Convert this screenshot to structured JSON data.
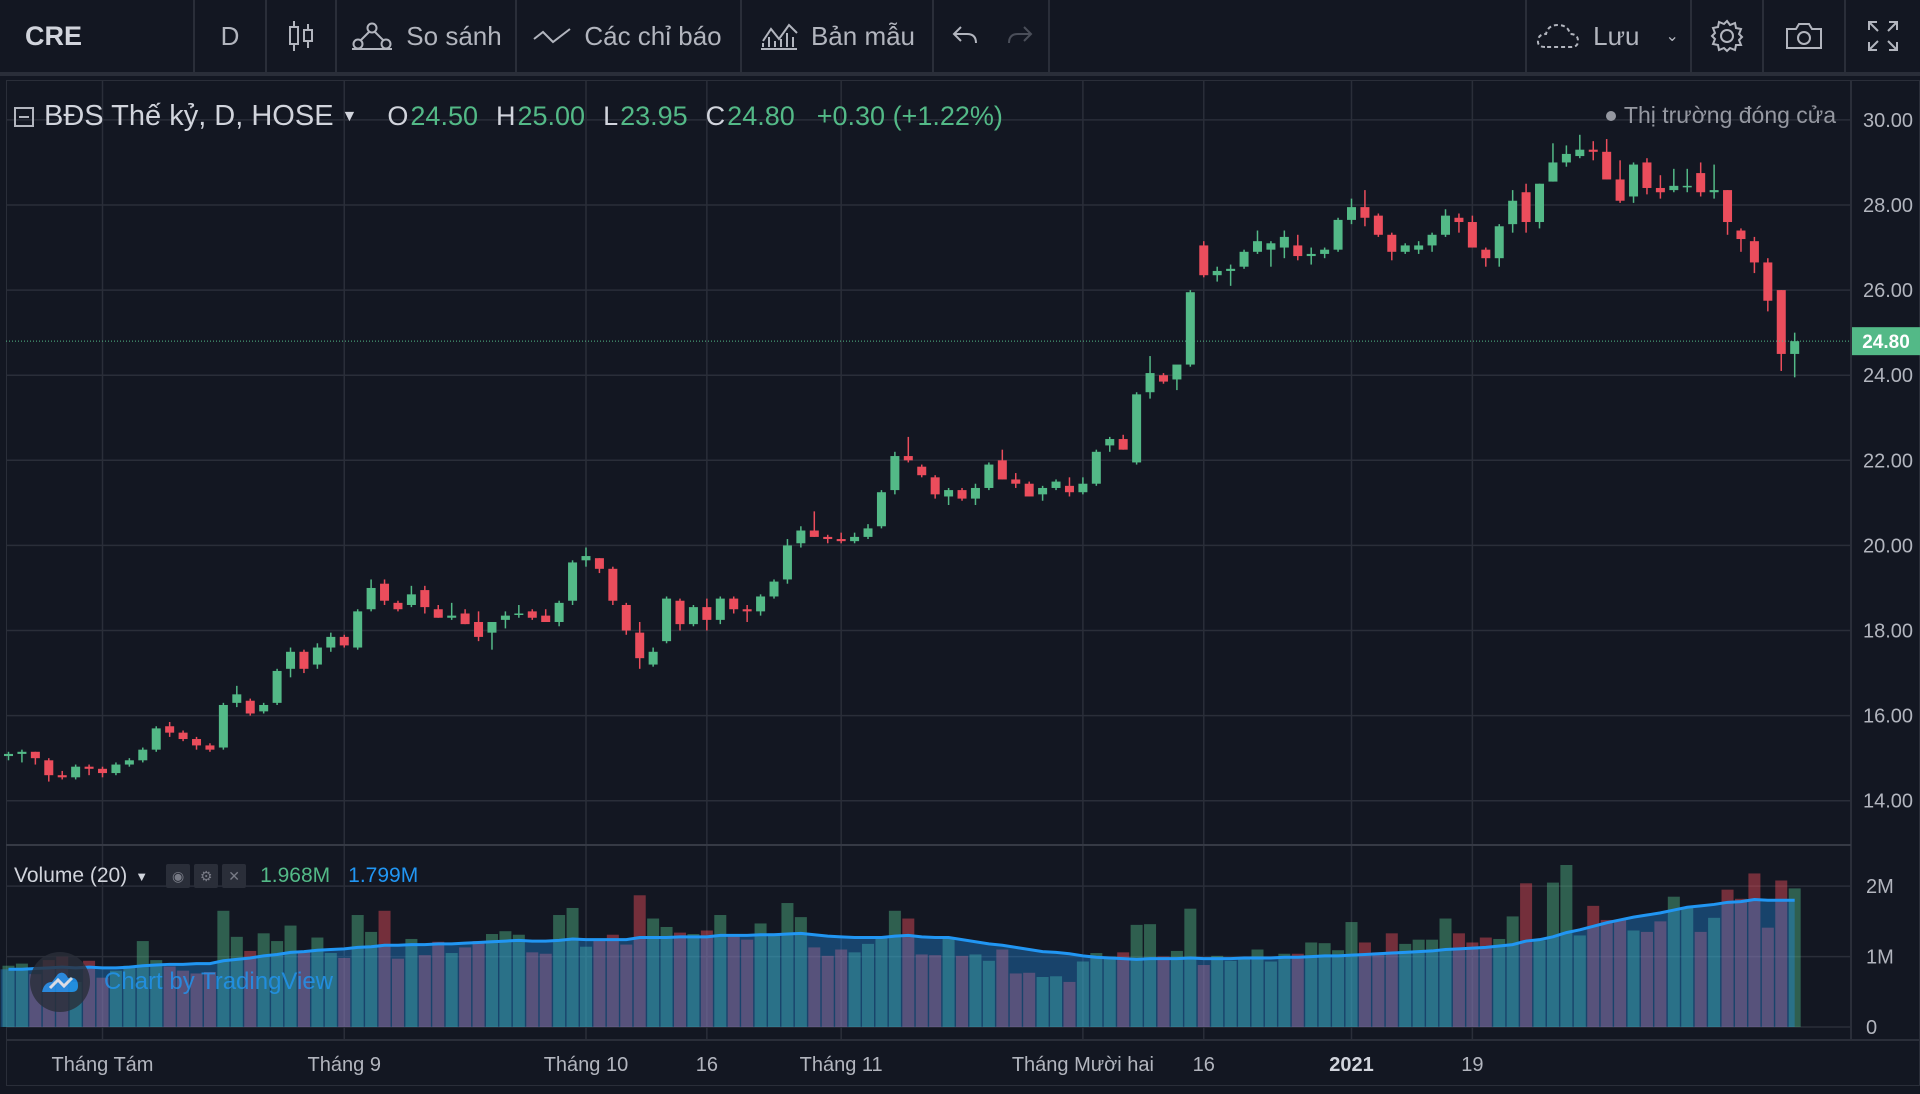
{
  "toolbar": {
    "symbol": "CRE",
    "interval": "D",
    "compare_label": "So sánh",
    "indicators_label": "Các chỉ báo",
    "templates_label": "Bản mẫu",
    "save_label": "Lưu"
  },
  "legend": {
    "title": "BĐS Thế kỷ, D, HOSE",
    "open_key": "O",
    "open": "24.50",
    "high_key": "H",
    "high": "25.00",
    "low_key": "L",
    "low": "23.95",
    "close_key": "C",
    "close": "24.80",
    "change": "+0.30 (+1.22%)",
    "market_status": "Thị trường đóng cửa"
  },
  "volume_legend": {
    "title": "Volume (20)",
    "value": "1.968M",
    "ma": "1.799M"
  },
  "watermark": "Chart by TradingView",
  "price_axis": {
    "ticks": [
      "30.00",
      "28.00",
      "26.00",
      "24.00",
      "22.00",
      "20.00",
      "18.00",
      "16.00",
      "14.00"
    ],
    "last_price": "24.80"
  },
  "volume_axis": {
    "ticks": [
      "2M",
      "1M",
      "0"
    ]
  },
  "time_axis": {
    "labels": [
      {
        "text": "Tháng Tám",
        "bold": false
      },
      {
        "text": "Tháng 9",
        "bold": false
      },
      {
        "text": "Tháng 10",
        "bold": false
      },
      {
        "text": "16",
        "bold": false
      },
      {
        "text": "Tháng 11",
        "bold": false
      },
      {
        "text": "Tháng Mười hai",
        "bold": false
      },
      {
        "text": "16",
        "bold": false
      },
      {
        "text": "2021",
        "bold": true
      },
      {
        "text": "19",
        "bold": false
      }
    ]
  },
  "colors": {
    "up": "#53b987",
    "down": "#eb4d5c",
    "ma": "#2196f3",
    "background": "#131722",
    "grid": "#2a2e39"
  },
  "chart_data": {
    "type": "candlestick",
    "price_range": [
      13.5,
      30.35
    ],
    "volume_range": [
      0,
      2300000
    ],
    "ohlc": [
      [
        15.05,
        15.15,
        14.95,
        15.1
      ],
      [
        15.1,
        15.2,
        14.9,
        15.15
      ],
      [
        15.15,
        15.15,
        14.85,
        15.0
      ],
      [
        14.95,
        15.0,
        14.45,
        14.6
      ],
      [
        14.6,
        14.7,
        14.5,
        14.55
      ],
      [
        14.55,
        14.85,
        14.5,
        14.8
      ],
      [
        14.8,
        14.85,
        14.6,
        14.75
      ],
      [
        14.75,
        14.8,
        14.55,
        14.65
      ],
      [
        14.65,
        14.9,
        14.6,
        14.85
      ],
      [
        14.85,
        15.0,
        14.8,
        14.95
      ],
      [
        14.95,
        15.25,
        14.9,
        15.2
      ],
      [
        15.2,
        15.75,
        15.15,
        15.7
      ],
      [
        15.75,
        15.85,
        15.5,
        15.6
      ],
      [
        15.6,
        15.65,
        15.4,
        15.45
      ],
      [
        15.45,
        15.5,
        15.2,
        15.3
      ],
      [
        15.3,
        15.35,
        15.15,
        15.2
      ],
      [
        15.25,
        16.3,
        15.2,
        16.25
      ],
      [
        16.3,
        16.7,
        16.2,
        16.5
      ],
      [
        16.35,
        16.4,
        16.0,
        16.05
      ],
      [
        16.1,
        16.3,
        16.05,
        16.25
      ],
      [
        16.3,
        17.1,
        16.25,
        17.05
      ],
      [
        17.1,
        17.6,
        16.9,
        17.5
      ],
      [
        17.5,
        17.55,
        17.0,
        17.1
      ],
      [
        17.2,
        17.7,
        17.1,
        17.6
      ],
      [
        17.6,
        17.95,
        17.5,
        17.85
      ],
      [
        17.85,
        17.9,
        17.6,
        17.65
      ],
      [
        17.6,
        18.5,
        17.55,
        18.45
      ],
      [
        18.5,
        19.2,
        18.45,
        19.0
      ],
      [
        19.1,
        19.2,
        18.6,
        18.7
      ],
      [
        18.65,
        18.7,
        18.45,
        18.5
      ],
      [
        18.6,
        19.05,
        18.55,
        18.85
      ],
      [
        18.95,
        19.05,
        18.4,
        18.55
      ],
      [
        18.5,
        18.6,
        18.3,
        18.3
      ],
      [
        18.3,
        18.65,
        18.25,
        18.35
      ],
      [
        18.4,
        18.5,
        18.15,
        18.15
      ],
      [
        18.2,
        18.45,
        17.75,
        17.85
      ],
      [
        17.95,
        18.2,
        17.55,
        18.2
      ],
      [
        18.25,
        18.45,
        18.05,
        18.35
      ],
      [
        18.4,
        18.6,
        18.3,
        18.4
      ],
      [
        18.45,
        18.5,
        18.25,
        18.3
      ],
      [
        18.35,
        18.5,
        18.2,
        18.2
      ],
      [
        18.2,
        18.7,
        18.1,
        18.65
      ],
      [
        18.7,
        19.65,
        18.6,
        19.6
      ],
      [
        19.65,
        19.95,
        19.5,
        19.75
      ],
      [
        19.7,
        19.7,
        19.35,
        19.45
      ],
      [
        19.45,
        19.5,
        18.6,
        18.7
      ],
      [
        18.6,
        18.65,
        17.9,
        18.0
      ],
      [
        17.95,
        18.2,
        17.1,
        17.35
      ],
      [
        17.2,
        17.6,
        17.15,
        17.5
      ],
      [
        17.75,
        18.8,
        17.7,
        18.75
      ],
      [
        18.7,
        18.75,
        18.0,
        18.15
      ],
      [
        18.15,
        18.6,
        18.1,
        18.55
      ],
      [
        18.55,
        18.75,
        18.0,
        18.25
      ],
      [
        18.25,
        18.8,
        18.15,
        18.75
      ],
      [
        18.75,
        18.8,
        18.4,
        18.5
      ],
      [
        18.5,
        18.6,
        18.2,
        18.45
      ],
      [
        18.45,
        18.85,
        18.35,
        18.8
      ],
      [
        18.8,
        19.2,
        18.75,
        19.15
      ],
      [
        19.2,
        20.15,
        19.1,
        20.0
      ],
      [
        20.05,
        20.45,
        19.95,
        20.35
      ],
      [
        20.35,
        20.8,
        20.2,
        20.2
      ],
      [
        20.2,
        20.25,
        20.05,
        20.15
      ],
      [
        20.15,
        20.3,
        20.05,
        20.1
      ],
      [
        20.1,
        20.3,
        20.05,
        20.2
      ],
      [
        20.2,
        20.5,
        20.15,
        20.4
      ],
      [
        20.45,
        21.3,
        20.4,
        21.25
      ],
      [
        21.3,
        22.2,
        21.2,
        22.1
      ],
      [
        22.1,
        22.55,
        21.95,
        22.0
      ],
      [
        21.85,
        21.9,
        21.6,
        21.65
      ],
      [
        21.6,
        21.65,
        21.1,
        21.2
      ],
      [
        21.15,
        21.35,
        20.95,
        21.3
      ],
      [
        21.3,
        21.35,
        21.05,
        21.1
      ],
      [
        21.1,
        21.45,
        20.95,
        21.35
      ],
      [
        21.35,
        21.95,
        21.3,
        21.9
      ],
      [
        22.0,
        22.25,
        21.55,
        21.55
      ],
      [
        21.55,
        21.7,
        21.35,
        21.45
      ],
      [
        21.45,
        21.5,
        21.15,
        21.15
      ],
      [
        21.2,
        21.4,
        21.05,
        21.35
      ],
      [
        21.35,
        21.55,
        21.3,
        21.5
      ],
      [
        21.4,
        21.6,
        21.15,
        21.25
      ],
      [
        21.25,
        21.6,
        21.2,
        21.45
      ],
      [
        21.45,
        22.25,
        21.4,
        22.2
      ],
      [
        22.35,
        22.55,
        22.2,
        22.5
      ],
      [
        22.5,
        22.6,
        22.25,
        22.25
      ],
      [
        21.95,
        23.6,
        21.9,
        23.55
      ],
      [
        23.6,
        24.45,
        23.45,
        24.05
      ],
      [
        24.0,
        24.05,
        23.8,
        23.85
      ],
      [
        23.9,
        24.15,
        23.65,
        24.25
      ],
      [
        24.25,
        26.0,
        24.2,
        25.95
      ],
      [
        27.05,
        27.15,
        26.3,
        26.35
      ],
      [
        26.35,
        26.55,
        26.2,
        26.45
      ],
      [
        26.45,
        26.6,
        26.1,
        26.5
      ],
      [
        26.55,
        26.95,
        26.5,
        26.9
      ],
      [
        26.9,
        27.4,
        26.85,
        27.15
      ],
      [
        26.95,
        27.15,
        26.55,
        27.1
      ],
      [
        27.0,
        27.4,
        26.75,
        27.25
      ],
      [
        27.05,
        27.3,
        26.7,
        26.8
      ],
      [
        26.8,
        27.0,
        26.6,
        26.85
      ],
      [
        26.85,
        27.0,
        26.75,
        26.95
      ],
      [
        26.95,
        27.7,
        26.9,
        27.65
      ],
      [
        27.65,
        28.15,
        27.55,
        27.95
      ],
      [
        27.95,
        28.35,
        27.5,
        27.7
      ],
      [
        27.75,
        27.8,
        27.25,
        27.3
      ],
      [
        27.3,
        27.35,
        26.7,
        26.9
      ],
      [
        26.9,
        27.1,
        26.85,
        27.05
      ],
      [
        26.95,
        27.15,
        26.85,
        27.05
      ],
      [
        27.05,
        27.35,
        26.9,
        27.3
      ],
      [
        27.3,
        27.9,
        27.25,
        27.75
      ],
      [
        27.7,
        27.8,
        27.35,
        27.6
      ],
      [
        27.6,
        27.75,
        27.0,
        27.0
      ],
      [
        26.95,
        27.0,
        26.55,
        26.75
      ],
      [
        26.75,
        27.55,
        26.55,
        27.5
      ],
      [
        27.55,
        28.35,
        27.35,
        28.1
      ],
      [
        28.3,
        28.5,
        27.35,
        27.6
      ],
      [
        27.6,
        28.5,
        27.45,
        28.5
      ],
      [
        28.55,
        29.45,
        28.55,
        29.0
      ],
      [
        29.0,
        29.4,
        28.9,
        29.2
      ],
      [
        29.15,
        29.65,
        29.1,
        29.3
      ],
      [
        29.3,
        29.5,
        29.05,
        29.25
      ],
      [
        29.25,
        29.55,
        28.6,
        28.6
      ],
      [
        28.6,
        29.05,
        28.05,
        28.1
      ],
      [
        28.2,
        29.0,
        28.05,
        28.95
      ],
      [
        29.0,
        29.1,
        28.25,
        28.4
      ],
      [
        28.4,
        28.7,
        28.15,
        28.3
      ],
      [
        28.35,
        28.85,
        28.3,
        28.45
      ],
      [
        28.45,
        28.85,
        28.3,
        28.45
      ],
      [
        28.75,
        29.0,
        28.2,
        28.3
      ],
      [
        28.3,
        28.95,
        28.15,
        28.35
      ],
      [
        28.35,
        28.35,
        27.3,
        27.6
      ],
      [
        27.4,
        27.45,
        26.9,
        27.2
      ],
      [
        27.15,
        27.25,
        26.4,
        26.65
      ],
      [
        26.65,
        26.75,
        25.5,
        25.75
      ],
      [
        26.0,
        26.0,
        24.1,
        24.5
      ],
      [
        24.5,
        25.0,
        23.95,
        24.8
      ]
    ],
    "volume": [
      870000,
      900000,
      750000,
      950000,
      1000000,
      640000,
      940000,
      700000,
      800000,
      870000,
      1220000,
      950000,
      860000,
      800000,
      760000,
      780000,
      1650000,
      1280000,
      1080000,
      1330000,
      1220000,
      1440000,
      1060000,
      1270000,
      1050000,
      980000,
      1590000,
      1350000,
      1650000,
      970000,
      1250000,
      1020000,
      1210000,
      1050000,
      1130000,
      1220000,
      1320000,
      1360000,
      1310000,
      1060000,
      1040000,
      1590000,
      1690000,
      1140000,
      1240000,
      1310000,
      1170000,
      1870000,
      1540000,
      1420000,
      1340000,
      1320000,
      1370000,
      1590000,
      1310000,
      1240000,
      1470000,
      1330000,
      1760000,
      1560000,
      1130000,
      1010000,
      1100000,
      1060000,
      1180000,
      1270000,
      1650000,
      1540000,
      1030000,
      1020000,
      1260000,
      1010000,
      1030000,
      940000,
      1100000,
      760000,
      770000,
      710000,
      720000,
      640000,
      930000,
      1050000,
      1000000,
      1060000,
      1450000,
      1460000,
      1000000,
      1080000,
      1680000,
      880000,
      1010000,
      940000,
      980000,
      1100000,
      930000,
      1040000,
      1040000,
      1200000,
      1190000,
      1090000,
      1490000,
      1200000,
      1060000,
      1330000,
      1180000,
      1240000,
      1240000,
      1540000,
      1330000,
      1200000,
      1270000,
      1250000,
      1570000,
      2040000,
      1230000,
      2050000,
      2300000,
      1300000,
      1720000,
      1520000,
      1520000,
      1370000,
      1350000,
      1500000,
      1850000,
      1690000,
      1350000,
      1550000,
      1950000,
      1820000,
      2180000,
      1410000,
      2080000,
      1968000
    ],
    "volume_ma": [
      0.82,
      0.82,
      0.83,
      0.84,
      0.85,
      0.84,
      0.85,
      0.84,
      0.84,
      0.85,
      0.87,
      0.88,
      0.89,
      0.89,
      0.9,
      0.9,
      0.94,
      0.96,
      0.98,
      1.01,
      1.03,
      1.06,
      1.07,
      1.09,
      1.1,
      1.11,
      1.13,
      1.14,
      1.16,
      1.16,
      1.17,
      1.17,
      1.18,
      1.18,
      1.19,
      1.2,
      1.21,
      1.22,
      1.23,
      1.22,
      1.22,
      1.23,
      1.25,
      1.24,
      1.24,
      1.24,
      1.24,
      1.27,
      1.27,
      1.27,
      1.28,
      1.28,
      1.28,
      1.3,
      1.3,
      1.3,
      1.31,
      1.31,
      1.32,
      1.33,
      1.31,
      1.29,
      1.28,
      1.27,
      1.27,
      1.27,
      1.29,
      1.3,
      1.28,
      1.27,
      1.27,
      1.24,
      1.21,
      1.18,
      1.16,
      1.13,
      1.1,
      1.07,
      1.06,
      1.04,
      1.01,
      0.99,
      0.98,
      0.97,
      0.96,
      0.97,
      0.97,
      0.97,
      0.98,
      0.97,
      0.97,
      0.97,
      0.98,
      0.98,
      0.98,
      0.99,
      0.99,
      1.0,
      1.01,
      1.01,
      1.02,
      1.03,
      1.04,
      1.05,
      1.06,
      1.07,
      1.08,
      1.1,
      1.11,
      1.12,
      1.13,
      1.15,
      1.17,
      1.22,
      1.24,
      1.28,
      1.34,
      1.38,
      1.43,
      1.48,
      1.52,
      1.56,
      1.59,
      1.62,
      1.66,
      1.7,
      1.72,
      1.74,
      1.77,
      1.78,
      1.81,
      1.8,
      1.8,
      1.799
    ]
  }
}
